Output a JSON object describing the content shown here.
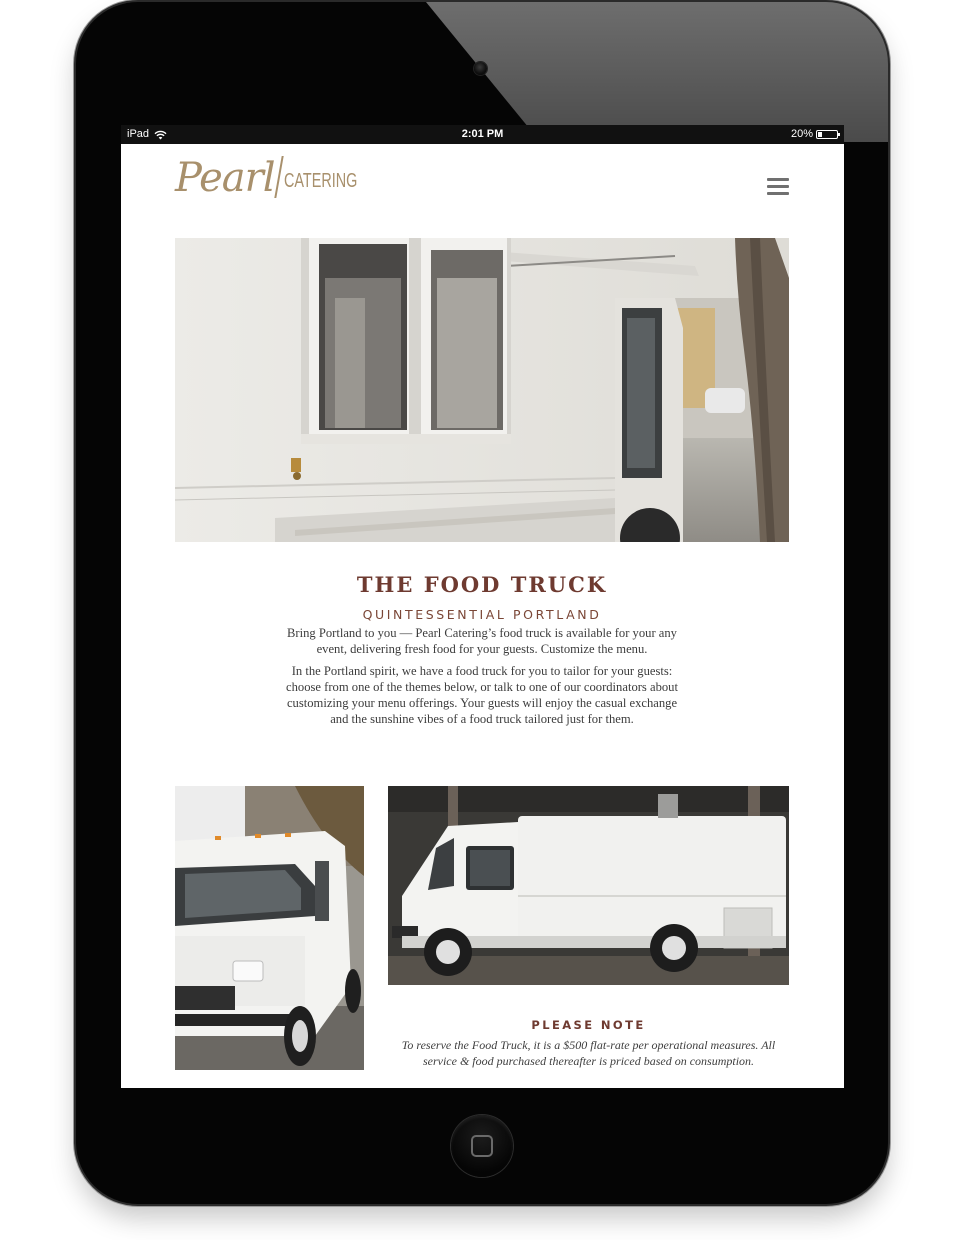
{
  "device": {
    "statusbar": {
      "carrier": "iPad",
      "time": "2:01 PM",
      "battery": "20%",
      "battery_level": 0.2
    }
  },
  "header": {
    "logo_script": "Pearl",
    "logo_word": "CATERING"
  },
  "content": {
    "title": "THE FOOD TRUCK",
    "subtitle": "QUINTESSENTIAL PORTLAND",
    "paragraphs": [
      "Bring Portland to you — Pearl Catering’s food truck is available for your any event, delivering fresh food for your guests. Customize the menu.",
      "In the Portland spirit, we have a food truck for you to tailor for your guests: choose from one of the themes below, or talk to one of our coordinators about customizing your menu offerings. Your guests will enjoy the casual exchange and the sunshine vibes of a food truck tailored just for them."
    ]
  },
  "note": {
    "title": "PLEASE NOTE",
    "text": "To reserve the Food Truck, it is a $500 flat-rate per operational measures. All service & food purchased thereafter is priced based on consumption."
  },
  "colors": {
    "brand_gold": "#a8906c",
    "heading_brown": "#6e3a30"
  },
  "icons": [
    "wifi-icon",
    "battery-icon",
    "menu-icon",
    "home-button-icon"
  ]
}
